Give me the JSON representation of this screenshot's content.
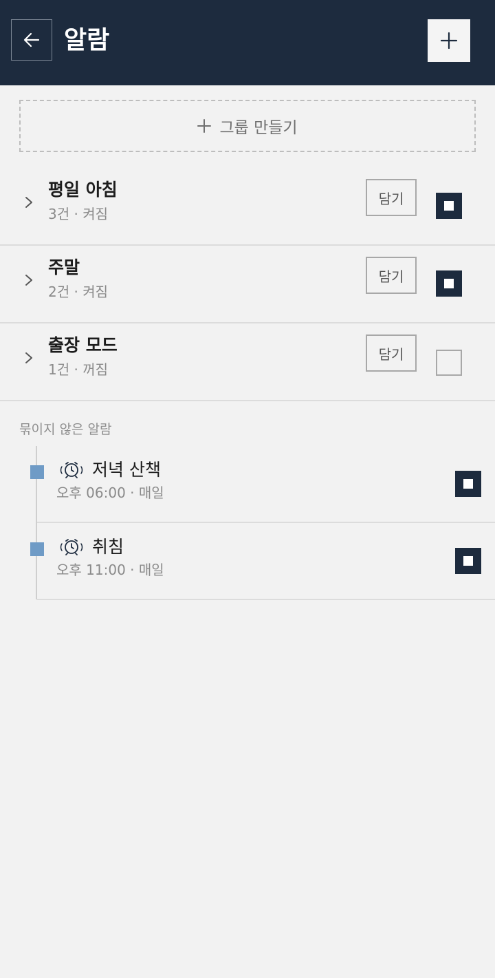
{
  "header": {
    "title": "알람"
  },
  "create_group": {
    "icon": "plus-icon",
    "label": "그룹 만들기"
  },
  "groups": [
    {
      "name": "평일 아침",
      "count": "3건",
      "state": "켜짐",
      "collect_label": "담기",
      "enabled": true
    },
    {
      "name": "주말",
      "count": "2건",
      "state": "켜짐",
      "collect_label": "담기",
      "enabled": true
    },
    {
      "name": "출장 모드",
      "count": "1건",
      "state": "꺼짐",
      "collect_label": "담기",
      "enabled": false
    }
  ],
  "ungrouped": {
    "label": "묶이지 않은 알람",
    "alarms": [
      {
        "icon": "alarm-clock-icon",
        "name": "저녁 산책",
        "time": "오후 06:00",
        "repeat": "매일",
        "enabled": true
      },
      {
        "icon": "alarm-clock-icon",
        "name": "취침",
        "time": "오후 11:00",
        "repeat": "매일",
        "enabled": true
      }
    ]
  },
  "separator": "·",
  "colors": {
    "header_bg": "#1d2b3e",
    "accent": "#1d2b3e",
    "node": "#6f9bc6",
    "background": "#f2f2f2"
  }
}
